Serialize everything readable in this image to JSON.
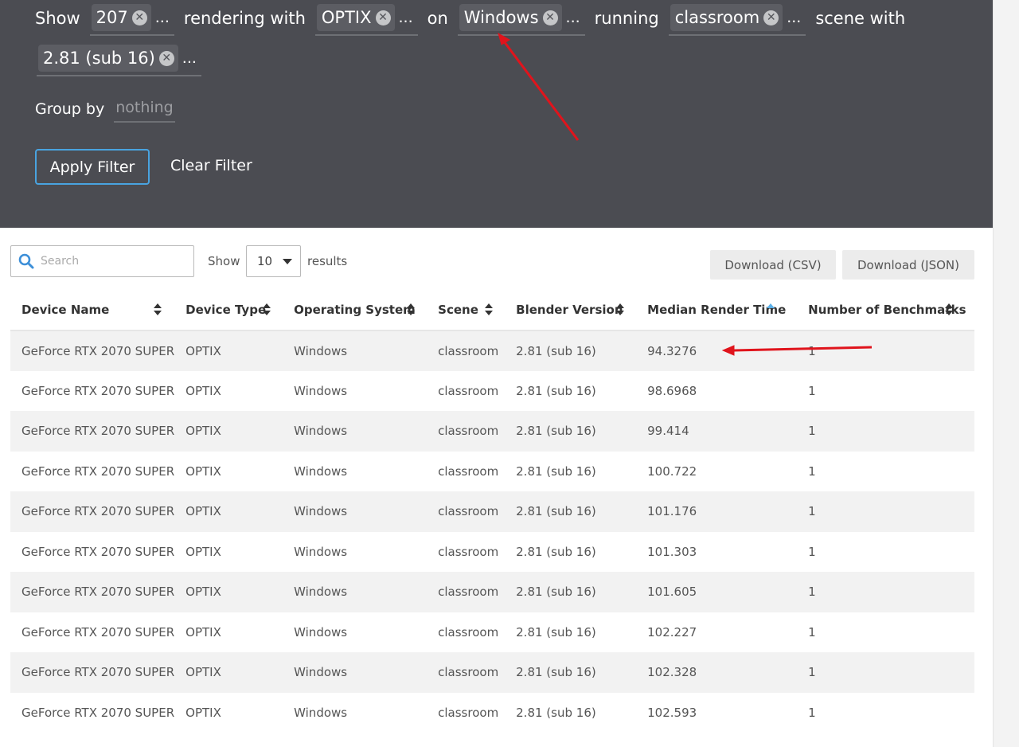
{
  "filter": {
    "show_word": "Show",
    "rendering_with_word": "rendering with",
    "on_word": "on",
    "running_word": "running",
    "scene_with_word": "scene with",
    "chips": {
      "device": "207",
      "device_type": "OPTIX",
      "os": "Windows",
      "scene": "classroom",
      "version": "2.81 (sub 16)"
    },
    "ellipsis": "...",
    "group_by_label": "Group by",
    "group_by_value": "nothing",
    "apply_label": "Apply Filter",
    "clear_label": "Clear Filter"
  },
  "toolbar": {
    "search_placeholder": "Search",
    "show_label": "Show",
    "page_size": "10",
    "results_label": "results",
    "download_csv": "Download (CSV)",
    "download_json": "Download (JSON)"
  },
  "table": {
    "columns": [
      "Device Name",
      "Device Type",
      "Operating System",
      "Scene",
      "Blender Version",
      "Median Render Time",
      "Number of Benchmarks"
    ],
    "sorted_column": "Median Render Time",
    "rows": [
      [
        "GeForce RTX 2070 SUPER",
        "OPTIX",
        "Windows",
        "classroom",
        "2.81 (sub 16)",
        "94.3276",
        "1"
      ],
      [
        "GeForce RTX 2070 SUPER",
        "OPTIX",
        "Windows",
        "classroom",
        "2.81 (sub 16)",
        "98.6968",
        "1"
      ],
      [
        "GeForce RTX 2070 SUPER",
        "OPTIX",
        "Windows",
        "classroom",
        "2.81 (sub 16)",
        "99.414",
        "1"
      ],
      [
        "GeForce RTX 2070 SUPER",
        "OPTIX",
        "Windows",
        "classroom",
        "2.81 (sub 16)",
        "100.722",
        "1"
      ],
      [
        "GeForce RTX 2070 SUPER",
        "OPTIX",
        "Windows",
        "classroom",
        "2.81 (sub 16)",
        "101.176",
        "1"
      ],
      [
        "GeForce RTX 2070 SUPER",
        "OPTIX",
        "Windows",
        "classroom",
        "2.81 (sub 16)",
        "101.303",
        "1"
      ],
      [
        "GeForce RTX 2070 SUPER",
        "OPTIX",
        "Windows",
        "classroom",
        "2.81 (sub 16)",
        "101.605",
        "1"
      ],
      [
        "GeForce RTX 2070 SUPER",
        "OPTIX",
        "Windows",
        "classroom",
        "2.81 (sub 16)",
        "102.227",
        "1"
      ],
      [
        "GeForce RTX 2070 SUPER",
        "OPTIX",
        "Windows",
        "classroom",
        "2.81 (sub 16)",
        "102.328",
        "1"
      ],
      [
        "GeForce RTX 2070 SUPER",
        "OPTIX",
        "Windows",
        "classroom",
        "2.81 (sub 16)",
        "102.593",
        "1"
      ]
    ]
  },
  "colors": {
    "panel_bg": "#4b4c52",
    "accent": "#49a3e0",
    "annotation_arrow": "#e0141c"
  }
}
